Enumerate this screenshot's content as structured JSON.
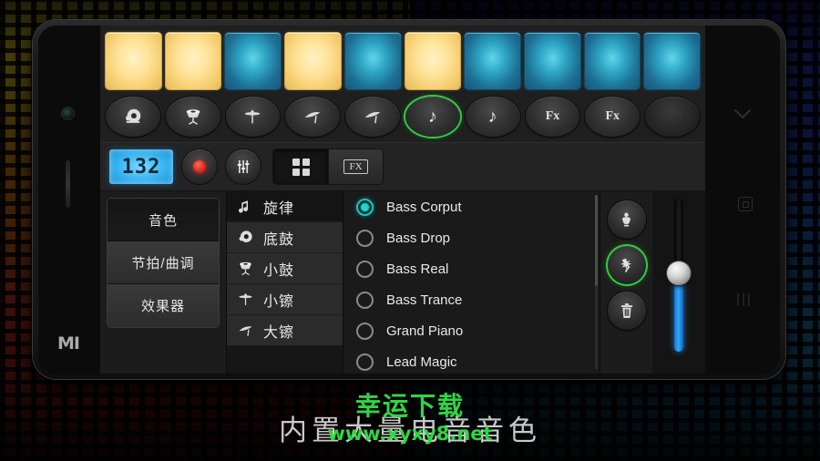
{
  "app": {
    "pads": [
      {
        "index": 1,
        "color": "yellow"
      },
      {
        "index": 2,
        "color": "yellow"
      },
      {
        "index": 3,
        "color": "blue"
      },
      {
        "index": 4,
        "color": "yellow"
      },
      {
        "index": 5,
        "color": "blue"
      },
      {
        "index": 6,
        "color": "yellow"
      },
      {
        "index": 7,
        "color": "blue"
      },
      {
        "index": 8,
        "color": "blue"
      },
      {
        "index": 9,
        "color": "blue"
      },
      {
        "index": 10,
        "color": "blue"
      }
    ],
    "pad_colors": {
      "yellow": "#ffe49a",
      "blue": "#2fa7c6"
    },
    "instruments": [
      {
        "icon": "kick-drum-icon",
        "glyph": "",
        "active": false
      },
      {
        "icon": "snare-drum-icon",
        "glyph": "",
        "active": false
      },
      {
        "icon": "hihat-cymbal-icon",
        "glyph": "",
        "active": false
      },
      {
        "icon": "crash-cymbal-icon",
        "glyph": "",
        "active": false
      },
      {
        "icon": "crash-cymbal-icon",
        "glyph": "",
        "active": false
      },
      {
        "icon": "music-note-icon",
        "glyph": "♪",
        "active": true
      },
      {
        "icon": "music-note-icon",
        "glyph": "♪",
        "active": false
      },
      {
        "icon": "fx-icon",
        "glyph": "Fx",
        "active": false
      },
      {
        "icon": "fx-icon",
        "glyph": "Fx",
        "active": false
      },
      {
        "icon": "empty-slot-icon",
        "glyph": "",
        "active": false
      }
    ],
    "transport": {
      "bpm_value": "132",
      "record_label": "",
      "mixer_label": "",
      "view_grid_label": "",
      "view_fx_label": "FX",
      "accent_green": "#2ecc40",
      "bpm_display_color": "#35b3f0",
      "record_color": "#e02a1c"
    },
    "tabs": [
      {
        "label": "音色",
        "active": true
      },
      {
        "label": "节拍/曲调",
        "active": false
      },
      {
        "label": "效果器",
        "active": false
      }
    ],
    "categories": [
      {
        "label": "旋律",
        "icon": "music-note-icon",
        "selected": true
      },
      {
        "label": "底鼓",
        "icon": "kick-drum-icon",
        "selected": false
      },
      {
        "label": "小鼓",
        "icon": "snare-drum-icon",
        "selected": false
      },
      {
        "label": "小镲",
        "icon": "hihat-cymbal-icon",
        "selected": false
      },
      {
        "label": "大镲",
        "icon": "crash-cymbal-icon",
        "selected": false
      }
    ],
    "sounds": [
      {
        "label": "Bass Corput",
        "selected": true
      },
      {
        "label": "Bass Drop",
        "selected": false
      },
      {
        "label": "Bass Real",
        "selected": false
      },
      {
        "label": "Bass Trance",
        "selected": false
      },
      {
        "label": "Grand Piano",
        "selected": false
      },
      {
        "label": "Lead Magic",
        "selected": false
      }
    ],
    "selected_sound_color": "#17d8d0",
    "actions": [
      {
        "icon": "touch-hand-icon",
        "active": false
      },
      {
        "icon": "magic-wand-icon",
        "active": true
      },
      {
        "icon": "trash-icon",
        "active": false
      }
    ],
    "volume": {
      "value_percent": 55,
      "color": "#35a8f5"
    }
  },
  "phone": {
    "brand_logo": "MI",
    "nav": {
      "back_icon": "chevron-down-icon",
      "home_icon": "home-square-icon",
      "recents_icon": "recents-bars-icon",
      "recents_glyph": "|||"
    }
  },
  "caption": {
    "text": "内置大量电音音色"
  },
  "watermark": {
    "title": "幸运下载",
    "url": "www.xyxy8.net",
    "color": "#2fd643"
  }
}
